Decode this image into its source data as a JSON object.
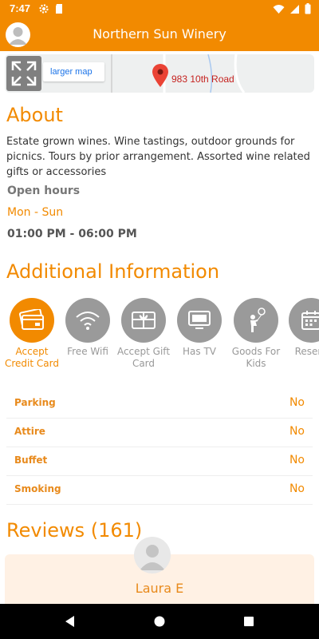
{
  "status_bar": {
    "time": "7:47",
    "icons": [
      "settings-icon",
      "sd-card-icon",
      "wifi-icon",
      "signal-icon",
      "battery-icon"
    ]
  },
  "app_bar": {
    "title": "Northern Sun Winery"
  },
  "map": {
    "larger_map_label": "larger map",
    "address": "983 10th Road"
  },
  "about": {
    "heading": "About",
    "description": "Estate grown wines. Wine tastings, outdoor grounds for picnics. Tours by prior arrangement. Assorted wine related gifts or accessories",
    "open_hours_label": "Open hours",
    "days": "Mon - Sun",
    "hours": "01:00 PM - 06:00 PM"
  },
  "additional": {
    "heading": "Additional Information",
    "amenities": [
      {
        "label": "Accept Credit Card",
        "icon": "credit-card-icon",
        "active": true
      },
      {
        "label": "Free Wifi",
        "icon": "wifi-icon",
        "active": false
      },
      {
        "label": "Accept Gift Card",
        "icon": "gift-card-icon",
        "active": false
      },
      {
        "label": "Has TV",
        "icon": "tv-icon",
        "active": false
      },
      {
        "label": "Goods For Kids",
        "icon": "kids-icon",
        "active": false
      },
      {
        "label": "Reserv",
        "icon": "calendar-icon",
        "active": false
      }
    ],
    "properties": [
      {
        "name": "Parking",
        "value": "No"
      },
      {
        "name": "Attire",
        "value": "No"
      },
      {
        "name": "Buffet",
        "value": "No"
      },
      {
        "name": "Smoking",
        "value": "No"
      }
    ]
  },
  "reviews": {
    "heading": "Reviews (161)",
    "first_reviewer": "Laura E"
  },
  "colors": {
    "accent": "#f28a00",
    "inactive": "#9a9a9a",
    "review_card": "#fff1e4"
  }
}
